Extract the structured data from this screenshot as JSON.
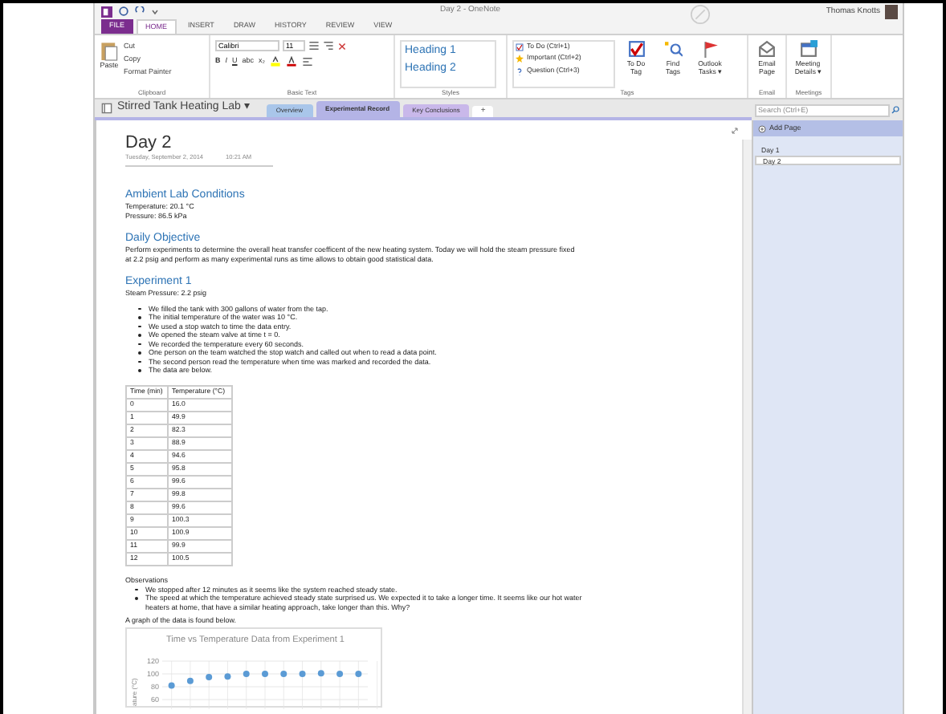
{
  "window": {
    "title": "Day 2 - OneNote"
  },
  "user": {
    "name": "Thomas Knotts"
  },
  "ribbon_tabs": [
    {
      "label": "FILE",
      "kind": "file",
      "selected": false
    },
    {
      "label": "HOME",
      "kind": "tab",
      "selected": true
    },
    {
      "label": "INSERT",
      "kind": "tab",
      "selected": false
    },
    {
      "label": "DRAW",
      "kind": "tab",
      "selected": false
    },
    {
      "label": "HISTORY",
      "kind": "tab",
      "selected": false
    },
    {
      "label": "REVIEW",
      "kind": "tab",
      "selected": false
    },
    {
      "label": "VIEW",
      "kind": "tab",
      "selected": false
    }
  ],
  "clipboard": {
    "paste": "Paste",
    "items": [
      "Cut",
      "Copy",
      "Format Painter"
    ],
    "label": "Clipboard"
  },
  "basic_text": {
    "font": "Calibri",
    "size": "11",
    "format_buttons": [
      "B",
      "I",
      "U",
      "abc",
      "x₂"
    ],
    "label": "Basic Text"
  },
  "styles": {
    "items": [
      "Heading 1",
      "Heading 2"
    ],
    "label": "Styles"
  },
  "tags": {
    "items": [
      "To Do (Ctrl+1)",
      "Important (Ctrl+2)",
      "Question (Ctrl+3)"
    ],
    "buttons": [
      [
        "To Do",
        "Tag"
      ],
      [
        "Find",
        "Tags"
      ],
      [
        "Outlook",
        "Tasks ▾"
      ]
    ],
    "label": "Tags"
  },
  "email": {
    "button": [
      "Email",
      "Page"
    ],
    "label": "Email"
  },
  "meetings": {
    "button": [
      "Meeting",
      "Details ▾"
    ],
    "label": "Meetings"
  },
  "notebook": {
    "name": "Stirred Tank Heating Lab ▾",
    "sections": [
      {
        "label": "Overview",
        "color": "#a9c6ea",
        "selected": false
      },
      {
        "label": "Experimental Record",
        "color": "#b4b4e6",
        "selected": true
      },
      {
        "label": "Key Conclusions",
        "color": "#c9b8ea",
        "selected": false
      }
    ],
    "add_section": "+"
  },
  "search": {
    "placeholder": "Search (Ctrl+E)"
  },
  "pages_panel": {
    "add_page": "Add Page",
    "pages": [
      {
        "title": "Day 1",
        "selected": false
      },
      {
        "title": "Day 2",
        "selected": true
      }
    ]
  },
  "page": {
    "title": "Day 2",
    "date": "Tuesday, September 2, 2014",
    "time": "10:21 AM",
    "sections": [
      {
        "heading": "Ambient Lab Conditions",
        "lines": [
          "Temperature: 20.1 °C",
          "Pressure: 86.5 kPa"
        ]
      },
      {
        "heading": "Daily Objective",
        "lines": [
          "Perform experiments to determine the overall heat transfer coefficent of the new heating system.  Today we will hold the steam pressure fixed at 2.2 psig and perform as many experimental runs as time allows to obtain good statistical data."
        ]
      },
      {
        "heading": "Experiment 1",
        "lines": [
          "Steam Pressure: 2.2 psig"
        ],
        "bullets": [
          "We filled the tank with 300 gallons of water from the tap.",
          "The initial temperature of the water was 10 °C.",
          "We used a stop watch to time the data entry.",
          "We opened the steam valve at time t = 0.",
          "We recorded the temperature every 60 seconds.",
          "One person on the team watched the stop watch and called out when to read a data point.",
          "The second person read the temperature when time was marked and recorded the data.",
          "The data are below."
        ]
      }
    ]
  },
  "table": {
    "columns": [
      "Time (min)",
      "Temperature (°C)"
    ],
    "rows": [
      [
        "0",
        "16.0"
      ],
      [
        "1",
        "49.9"
      ],
      [
        "2",
        "82.3"
      ],
      [
        "3",
        "88.9"
      ],
      [
        "4",
        "94.6"
      ],
      [
        "5",
        "95.8"
      ],
      [
        "6",
        "99.6"
      ],
      [
        "7",
        "99.8"
      ],
      [
        "8",
        "99.6"
      ],
      [
        "9",
        "100.3"
      ],
      [
        "10",
        "100.9"
      ],
      [
        "11",
        "99.9"
      ],
      [
        "12",
        "100.5"
      ]
    ]
  },
  "observations": {
    "label": "Observations",
    "bullets": [
      "We stopped after 12 minutes as it seems like the system reached steady state.",
      "The speed at which the temperature achieved steady state surprised us.  We expected it to take a longer time.  It seems like our hot water heaters at home, that have a similar heating approach, take longer than this.  Why?"
    ]
  },
  "graph_caption": "A graph of the data is found below.",
  "chart_data": {
    "type": "scatter",
    "title": "Time vs Temperature Data from Experiment 1",
    "ylabel": "ature (°C)",
    "yticks": [
      60,
      80,
      100,
      120
    ],
    "ylim": [
      55,
      125
    ],
    "grid": true,
    "categories": [
      null,
      null,
      null,
      null,
      null,
      null,
      null,
      null,
      null,
      null,
      null
    ],
    "series": [
      {
        "color": "#5b9bd5",
        "values": [
          82,
          89,
          95,
          96,
          100,
          100,
          100,
          100,
          101,
          100,
          100
        ]
      }
    ]
  }
}
